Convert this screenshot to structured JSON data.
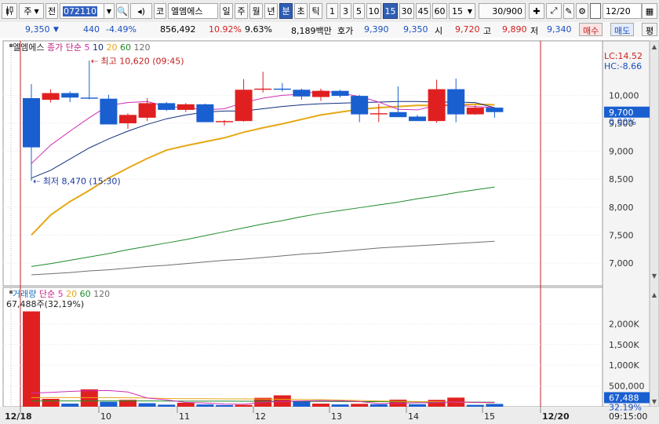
{
  "toolbar": {
    "type_label": "주",
    "prev_label": "전",
    "code_value": "072110",
    "market_label": "코",
    "stock_name": "엘엠에스",
    "periods": [
      "일",
      "주",
      "월",
      "년",
      "분",
      "초",
      "틱"
    ],
    "active_period": "분",
    "intervals": [
      "1",
      "3",
      "5",
      "10",
      "15",
      "30",
      "45",
      "60"
    ],
    "active_interval": "15",
    "interval_select": "15",
    "count_value": "30",
    "count_total": "/900",
    "date_value": "12/20"
  },
  "info": {
    "price": "9,350",
    "change": "440",
    "change_pct": "-4.49%",
    "volume": "856,492",
    "vol_ratio": "10.92%",
    "turnover": "9.63%",
    "amount": "8,189백만",
    "ask_label": "호가",
    "ask1": "9,390",
    "ask2": "9,350",
    "open_label": "시",
    "open": "9,720",
    "high_label": "고",
    "high": "9,890",
    "low_label": "저",
    "low": "9,340",
    "buy_label": "매수",
    "sell_label": "매도",
    "eval_label": "평"
  },
  "colors": {
    "up": "#e02020",
    "down": "#1a5fd0",
    "ma5": "#d02cb4",
    "ma10": "#112f7c",
    "ma20": "#e6a814",
    "ma60": "#1f8a2a",
    "ma120": "#6e6e6e",
    "vline": "#c0202a"
  },
  "chart_data": [
    {
      "type": "candlestick",
      "title": "엘엠에스",
      "legend_prefix": "종가 단순",
      "ma_periods": [
        "5",
        "10",
        "20",
        "60",
        "120"
      ],
      "right_labels": {
        "lc": "LC:14.52",
        "hc": "HC:-8.66",
        "current": "9,700",
        "pct": "0.00%"
      },
      "annotations": {
        "high": "최고 10,620 (09:45)",
        "low": "최저 8,470 (15:30)"
      },
      "ylim": [
        6650,
        10750
      ],
      "y_ticks": [
        7000,
        7500,
        8000,
        8500,
        9000,
        9500,
        10000
      ],
      "y_tick_labels": [
        "7,000",
        "7,500",
        "8,000",
        "8,500",
        "9,000",
        "9,500",
        "10,000"
      ],
      "candles": [
        {
          "o": 9950,
          "h": 10200,
          "l": 8470,
          "c": 9070
        },
        {
          "o": 9920,
          "h": 10110,
          "l": 9870,
          "c": 10040
        },
        {
          "o": 10040,
          "h": 10070,
          "l": 9880,
          "c": 9960
        },
        {
          "o": 9960,
          "h": 10620,
          "l": 9930,
          "c": 9940
        },
        {
          "o": 9940,
          "h": 10010,
          "l": 9850,
          "c": 9480
        },
        {
          "o": 9500,
          "h": 9680,
          "l": 9400,
          "c": 9650
        },
        {
          "o": 9600,
          "h": 9950,
          "l": 9540,
          "c": 9860
        },
        {
          "o": 9860,
          "h": 9880,
          "l": 9720,
          "c": 9740
        },
        {
          "o": 9740,
          "h": 9860,
          "l": 9700,
          "c": 9840
        },
        {
          "o": 9840,
          "h": 9850,
          "l": 9520,
          "c": 9520
        },
        {
          "o": 9520,
          "h": 9560,
          "l": 9460,
          "c": 9540
        },
        {
          "o": 9540,
          "h": 10290,
          "l": 9530,
          "c": 10100
        },
        {
          "o": 10100,
          "h": 10420,
          "l": 10050,
          "c": 10120
        },
        {
          "o": 10120,
          "h": 10220,
          "l": 10070,
          "c": 10100
        },
        {
          "o": 10100,
          "h": 10120,
          "l": 9920,
          "c": 9980
        },
        {
          "o": 9970,
          "h": 10120,
          "l": 9900,
          "c": 10080
        },
        {
          "o": 10080,
          "h": 10100,
          "l": 9960,
          "c": 9990
        },
        {
          "o": 9990,
          "h": 10010,
          "l": 9520,
          "c": 9660
        },
        {
          "o": 9660,
          "h": 9850,
          "l": 9520,
          "c": 9680
        },
        {
          "o": 9700,
          "h": 10160,
          "l": 9620,
          "c": 9610
        },
        {
          "o": 9620,
          "h": 9650,
          "l": 9540,
          "c": 9540
        },
        {
          "o": 9540,
          "h": 10280,
          "l": 9510,
          "c": 10110
        },
        {
          "o": 10110,
          "h": 10300,
          "l": 9520,
          "c": 9660
        },
        {
          "o": 9660,
          "h": 9820,
          "l": 9650,
          "c": 9780
        },
        {
          "o": 9780,
          "h": 9790,
          "l": 9600,
          "c": 9700
        }
      ],
      "ma5": [
        8780,
        9110,
        9360,
        9600,
        9820,
        9870,
        9890,
        9800,
        9780,
        9740,
        9760,
        9870,
        9950,
        10000,
        10020,
        10080,
        10040,
        9980,
        9880,
        9750,
        9740,
        9820,
        9820,
        9800,
        9780
      ],
      "ma10": [
        8520,
        8660,
        8860,
        9060,
        9220,
        9360,
        9480,
        9580,
        9650,
        9700,
        9720,
        9720,
        9760,
        9800,
        9830,
        9850,
        9860,
        9870,
        9880,
        9890,
        9890,
        9880,
        9880,
        9870,
        9780
      ],
      "ma20": [
        7500,
        7860,
        8100,
        8300,
        8520,
        8700,
        8870,
        9020,
        9100,
        9170,
        9240,
        9340,
        9420,
        9490,
        9570,
        9650,
        9700,
        9750,
        9780,
        9800,
        9820,
        9820,
        9830,
        9840,
        9830
      ],
      "ma60": [
        6940,
        6990,
        7050,
        7110,
        7170,
        7240,
        7300,
        7360,
        7420,
        7490,
        7560,
        7630,
        7700,
        7760,
        7830,
        7890,
        7940,
        7990,
        8040,
        8090,
        8150,
        8200,
        8260,
        8310,
        8360
      ],
      "ma120": [
        6790,
        6810,
        6830,
        6860,
        6880,
        6910,
        6940,
        6960,
        6990,
        7020,
        7050,
        7070,
        7100,
        7130,
        7160,
        7180,
        7210,
        7240,
        7270,
        7290,
        7310,
        7330,
        7350,
        7370,
        7390
      ]
    },
    {
      "type": "bar",
      "title": "거래량",
      "legend_prefix": "단순",
      "ma_periods": [
        "5",
        "20",
        "60",
        "120"
      ],
      "value_label": "67,488주(32,19%)",
      "right_labels": {
        "current": "67,488",
        "pct": "32.19%"
      },
      "ylim": [
        0,
        2500000
      ],
      "y_ticks": [
        500000,
        1000000,
        1500000,
        2000000
      ],
      "y_tick_labels": [
        "500,000",
        "1,000K",
        "1,500K",
        "2,000K"
      ],
      "values": [
        2300000,
        190000,
        75000,
        420000,
        120000,
        165000,
        85000,
        50000,
        95000,
        55000,
        40000,
        45000,
        215000,
        275000,
        125000,
        75000,
        55000,
        70000,
        60000,
        170000,
        60000,
        165000,
        220000,
        45000,
        67488
      ],
      "up": [
        true,
        true,
        false,
        true,
        false,
        true,
        false,
        false,
        true,
        false,
        false,
        true,
        true,
        true,
        false,
        true,
        false,
        true,
        false,
        true,
        false,
        true,
        true,
        false,
        false
      ],
      "ma5": [
        330000,
        345000,
        370000,
        385000,
        390000,
        355000,
        210000,
        165000,
        105000,
        90000,
        65000,
        60000,
        110000,
        130000,
        140000,
        150000,
        145000,
        125000,
        75000,
        85000,
        95000,
        100000,
        115000,
        105000,
        105000
      ],
      "ma20": [
        220000,
        220000,
        220000,
        220000,
        220000,
        215000,
        210000,
        200000,
        195000,
        195000,
        190000,
        190000,
        185000,
        180000,
        175000,
        170000,
        160000,
        150000,
        140000,
        130000,
        125000,
        120000,
        110000,
        100000,
        95000
      ],
      "ma60": [
        140000,
        140000,
        140000,
        140000,
        140000,
        140000,
        140000,
        138000,
        136000,
        135000,
        134000,
        133000,
        132000,
        131000,
        130000,
        128000,
        126000,
        124000,
        122000,
        120000,
        118000,
        116000,
        114000,
        112000,
        110000
      ]
    }
  ],
  "x_axis": {
    "labels": [
      "12/18",
      "10",
      "11",
      "12",
      "13",
      "14",
      "15",
      "12/20"
    ],
    "time": "09:15:00"
  }
}
